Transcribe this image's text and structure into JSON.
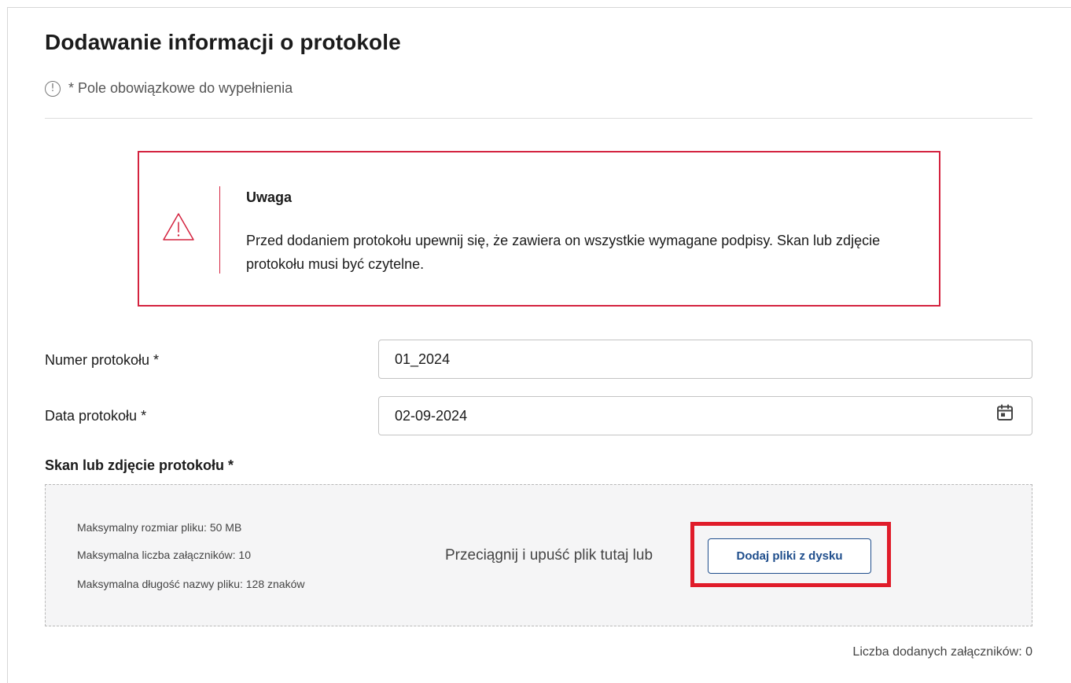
{
  "page": {
    "title": "Dodawanie informacji o protokole",
    "required_note": "* Pole obowiązkowe do wypełnienia",
    "info_icon_glyph": "!"
  },
  "alert": {
    "icon": "warning-triangle-icon",
    "color": "#d4233f",
    "heading": "Uwaga",
    "text": "Przed dodaniem protokołu upewnij się, że zawiera on wszystkie wymagane podpisy. Skan lub zdjęcie protokołu musi być czytelne."
  },
  "form": {
    "protocol_number": {
      "label": "Numer protokołu *",
      "value": "01_2024"
    },
    "protocol_date": {
      "label": "Data protokołu  *",
      "value": "02-09-2024",
      "icon": "calendar-icon"
    }
  },
  "upload": {
    "section_title": "Skan lub zdjęcie protokołu *",
    "limits": [
      "Maksymalny rozmiar pliku: 50 MB",
      "Maksymalna liczba załączników: 10",
      "Maksymalna długość nazwy pliku: 128 znaków"
    ],
    "drop_text": "Przeciągnij i upuść plik tutaj lub",
    "button_label": "Dodaj pliki z dysku",
    "button_color": "#1f4e8c",
    "highlight_color": "#e01c2a",
    "attachments_count": "Liczba dodanych załączników: 0"
  }
}
